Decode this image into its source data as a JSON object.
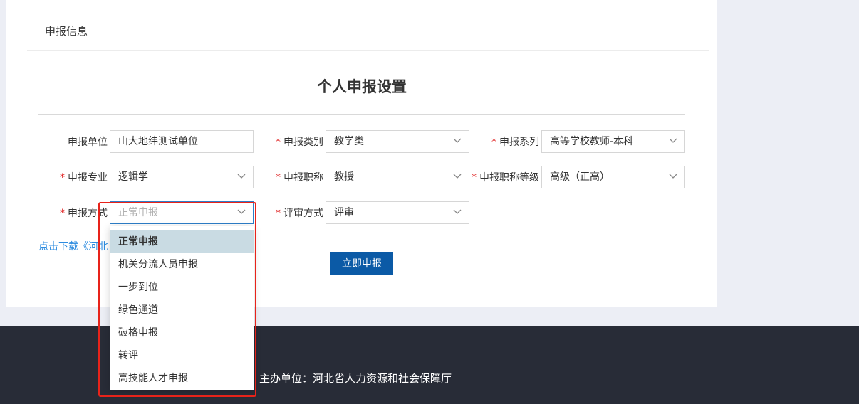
{
  "section": {
    "title": "申报信息"
  },
  "form": {
    "title": "个人申报设置",
    "required_mark": "*",
    "fields": {
      "unit": {
        "label": "申报单位",
        "value": "山大地纬测试单位"
      },
      "category": {
        "label": "申报类别",
        "value": "教学类"
      },
      "series": {
        "label": "申报系列",
        "value": "高等学校教师-本科"
      },
      "major": {
        "label": "申报专业",
        "value": "逻辑学"
      },
      "title_name": {
        "label": "申报职称",
        "value": "教授"
      },
      "title_level": {
        "label": "申报职称等级",
        "value": "高级（正高）"
      },
      "method": {
        "label": "申报方式",
        "placeholder": "正常申报"
      },
      "review": {
        "label": "评审方式",
        "value": "评审"
      }
    },
    "download_link": "点击下载《河北",
    "submit_label": "立即申报"
  },
  "dropdown": {
    "options": [
      "正常申报",
      "机关分流人员申报",
      "一步到位",
      "绿色通道",
      "破格申报",
      "转评",
      "高技能人才申报"
    ],
    "selected_index": 0
  },
  "footer": {
    "text": "主办单位：河北省人力资源和社会保障厅"
  },
  "colors": {
    "primary": "#0b5aa6",
    "link": "#2d8ce0",
    "required": "#e02020",
    "highlight": "#e8231a",
    "footer_bg": "#282c37"
  }
}
